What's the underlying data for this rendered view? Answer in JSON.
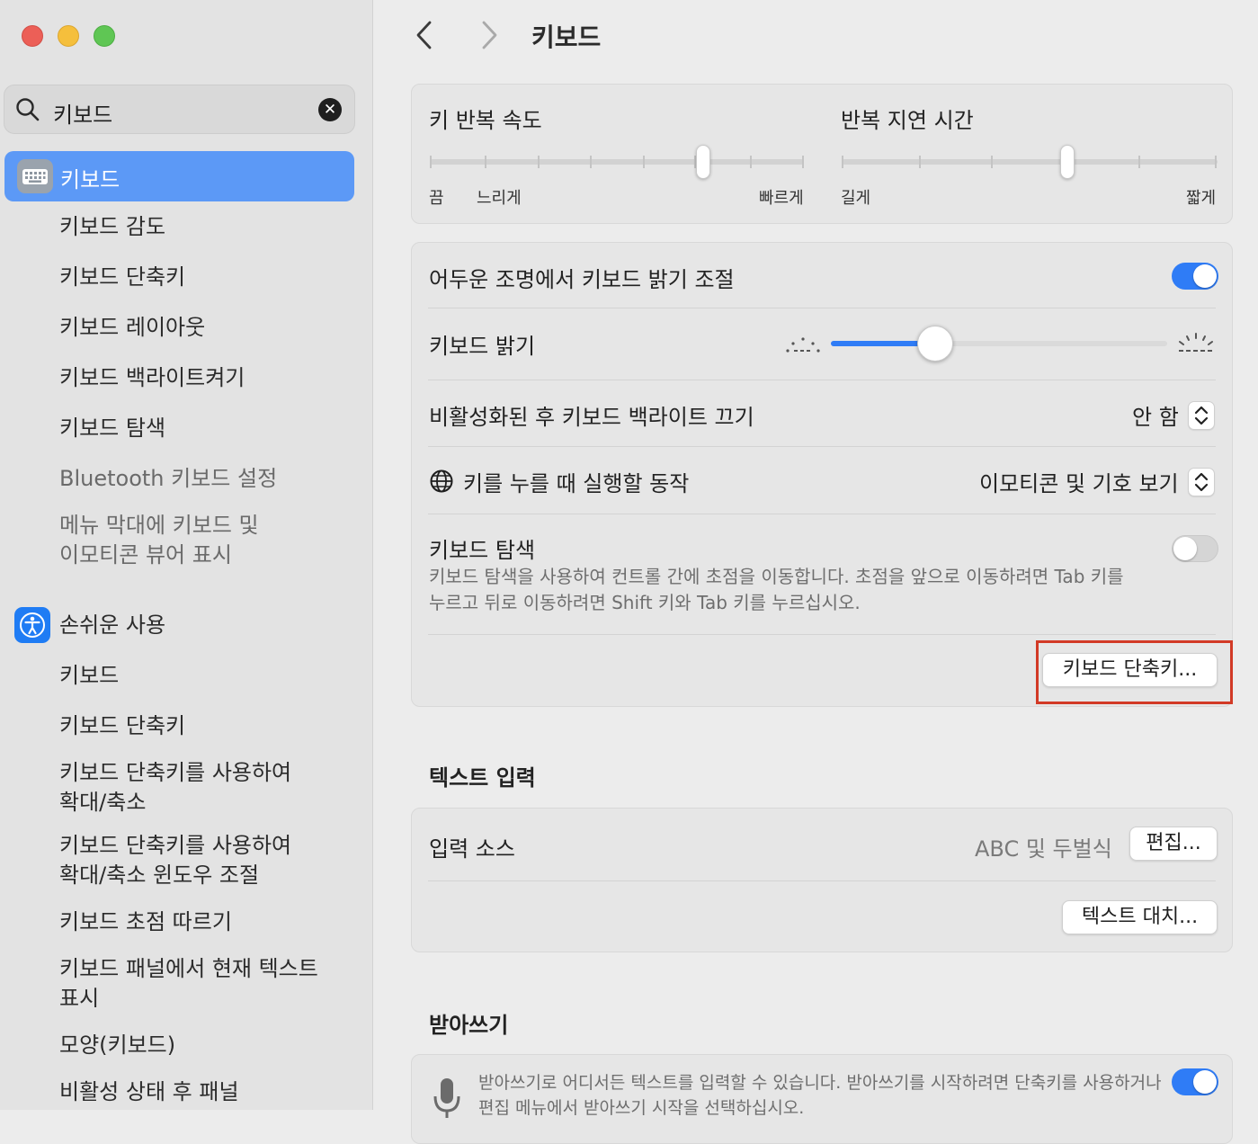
{
  "window": {
    "title": "키보드"
  },
  "sidebar": {
    "search": {
      "value": "키보드"
    },
    "selected": {
      "label": "키보드",
      "icon": "keyboard-icon"
    },
    "keyboard_items": [
      "키보드 감도",
      "키보드 단축키",
      "키보드 레이아웃",
      "키보드 백라이트켜기",
      "키보드 탐색",
      "Bluetooth 키보드 설정",
      "메뉴 막대에 키보드 및",
      "이모티콘 뷰어 표시"
    ],
    "accessibility": {
      "label": "손쉬운 사용",
      "icon": "accessibility-icon"
    },
    "accessibility_items": [
      "키보드",
      "키보드 단축키",
      "키보드 단축키를 사용하여",
      "확대/축소",
      "키보드 단축키를 사용하여",
      "확대/축소 윈도우 조절",
      "키보드 초점 따르기",
      "키보드 패널에서 현재 텍스트",
      "표시",
      "모양(키보드)",
      "비활성 상태 후 패널"
    ]
  },
  "main": {
    "repeat": {
      "rate_title": "키 반복 속도",
      "rate_labels": [
        "끔",
        "느리게",
        "빠르게"
      ],
      "rate_value": 0.73,
      "delay_title": "반복 지연 시간",
      "delay_labels": [
        "길게",
        "짧게"
      ],
      "delay_value": 0.6
    },
    "backlight": {
      "auto_adjust_label": "어두운 조명에서 키보드 밝기 조절",
      "auto_adjust_on": true,
      "brightness_label": "키보드 밝기",
      "brightness_value": 0.31,
      "turn_off_label": "비활성화된 후 키보드 백라이트 끄기",
      "turn_off_value": "안 함",
      "globe_label": "키를 누를 때 실행할 동작",
      "globe_value": "이모티콘 및 기호 보기",
      "nav_title": "키보드 탐색",
      "nav_desc_1": "키보드 탐색을 사용하여 컨트롤 간에 초점을 이동합니다. 초점을 앞으로 이동하려면 Tab 키를",
      "nav_desc_2": "누르고 뒤로 이동하려면 Shift 키와 Tab 키를 누르십시오.",
      "nav_on": false,
      "shortcuts_button": "키보드 단축키..."
    },
    "text_input": {
      "section_title": "텍스트 입력",
      "input_sources_label": "입력 소스",
      "input_sources_value": "ABC 및 두벌식",
      "edit_button": "편집...",
      "replacements_button": "텍스트 대치..."
    },
    "dictation": {
      "section_title": "받아쓰기",
      "desc_1": "받아쓰기로 어디서든 텍스트를 입력할 수 있습니다. 받아쓰기를 시작하려면 단축키를 사용하거나",
      "desc_2": "편집 메뉴에서 받아쓰기 시작을 선택하십시오.",
      "enabled": true
    }
  },
  "colors": {
    "accent": "#2f7cf6",
    "selection": "#5c99f6",
    "highlight_box": "#d23a26"
  }
}
